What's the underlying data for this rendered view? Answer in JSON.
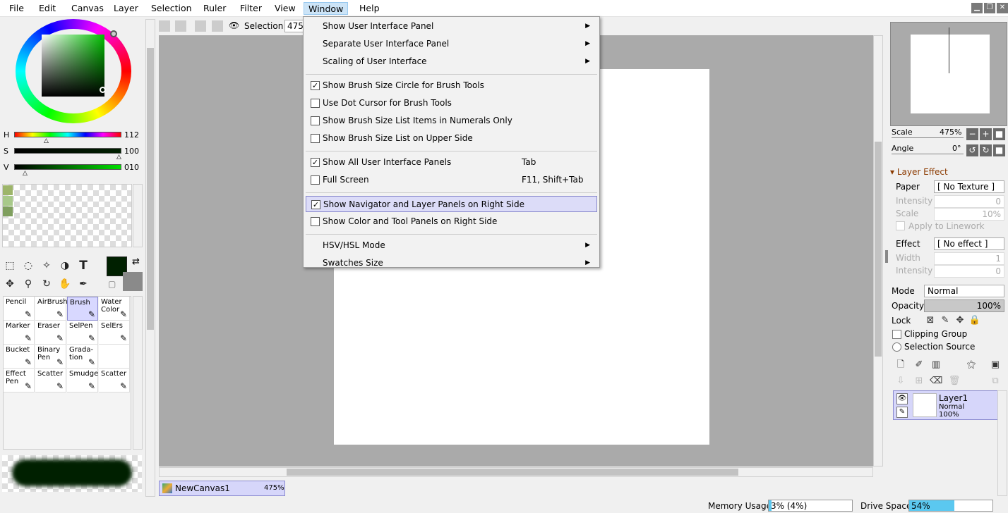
{
  "menubar": {
    "items": [
      "File",
      "Edit",
      "Canvas",
      "Layer",
      "Selection",
      "Ruler",
      "Filter",
      "View",
      "Window",
      "Help"
    ],
    "active": "Window"
  },
  "color_panel": {
    "h_label": "H",
    "h_value": "112",
    "s_label": "S",
    "s_value": "100",
    "v_label": "V",
    "v_value": "010",
    "swatches": [
      "#9db56a",
      "#a8c98a",
      "#7f9f5e"
    ],
    "primary_color": "#002000",
    "secondary_color": "#8a8a8a"
  },
  "brush_tools": {
    "cells": [
      {
        "label": "Pencil",
        "icon": "pencil-icon"
      },
      {
        "label": "AirBrush",
        "icon": "airbrush-icon"
      },
      {
        "label": "Brush",
        "icon": "brush-icon",
        "selected": true
      },
      {
        "label": "Water Color",
        "icon": "watercolor-icon"
      },
      {
        "label": "Marker",
        "icon": "marker-icon"
      },
      {
        "label": "Eraser",
        "icon": "eraser-icon"
      },
      {
        "label": "SelPen",
        "icon": "selpen-icon"
      },
      {
        "label": "SelErs",
        "icon": "selers-icon"
      },
      {
        "label": "Bucket",
        "icon": "bucket-icon"
      },
      {
        "label": "Binary Pen",
        "icon": "binary-pen-icon"
      },
      {
        "label": "Grada- tion",
        "icon": "gradation-icon"
      },
      {
        "label": "",
        "icon": ""
      },
      {
        "label": "Effect Pen",
        "icon": "effect-pen-icon"
      },
      {
        "label": "Scatter",
        "icon": "scatter-icon"
      },
      {
        "label": "Smudge",
        "icon": "smudge-icon"
      },
      {
        "label": "Scatter",
        "icon": "scatter-icon"
      }
    ]
  },
  "toolbar": {
    "selection_label": "Selection",
    "selection_value": "475"
  },
  "window_menu": {
    "groups": [
      [
        {
          "label": "Show User Interface Panel",
          "submenu": true
        },
        {
          "label": "Separate User Interface Panel",
          "submenu": true
        },
        {
          "label": "Scaling of User Interface",
          "submenu": true
        }
      ],
      [
        {
          "label": "Show Brush Size Circle for Brush Tools",
          "checkbox": true,
          "checked": true
        },
        {
          "label": "Use Dot Cursor for Brush Tools",
          "checkbox": true,
          "checked": false
        },
        {
          "label": "Show Brush Size List Items in Numerals Only",
          "checkbox": true,
          "checked": false
        },
        {
          "label": "Show Brush Size List on Upper Side",
          "checkbox": true,
          "checked": false
        }
      ],
      [
        {
          "label": "Show All User Interface Panels",
          "checkbox": true,
          "checked": true,
          "shortcut": "Tab"
        },
        {
          "label": "Full Screen",
          "checkbox": true,
          "checked": false,
          "shortcut": "F11, Shift+Tab"
        }
      ],
      [
        {
          "label": "Show Navigator and Layer Panels on Right Side",
          "checkbox": true,
          "checked": true,
          "highlighted": true
        },
        {
          "label": "Show Color and Tool Panels on Right Side",
          "checkbox": true,
          "checked": false
        }
      ],
      [
        {
          "label": "HSV/HSL Mode",
          "submenu": true
        },
        {
          "label": "Swatches Size",
          "submenu": true
        }
      ]
    ]
  },
  "canvas_tab": {
    "name": "NewCanvas1",
    "zoom": "475%"
  },
  "navigator": {
    "scale_label": "Scale",
    "scale_value": "475%",
    "angle_label": "Angle",
    "angle_value": "0°"
  },
  "layer_effect": {
    "title": "Layer Effect",
    "paper_label": "Paper",
    "paper_value": "[ No Texture ]",
    "intensity_label": "Intensity",
    "intensity_value": "0",
    "scale_label": "Scale",
    "scale_value": "10%",
    "apply_linework_label": "Apply to Linework",
    "effect_label": "Effect",
    "effect_value": "[ No effect ]",
    "width_label": "Width",
    "width_value": "1",
    "intensity2_label": "Intensity",
    "intensity2_value": "0"
  },
  "layer_props": {
    "mode_label": "Mode",
    "mode_value": "Normal",
    "opacity_label": "Opacity",
    "opacity_value": "100%",
    "lock_label": "Lock",
    "clipping_label": "Clipping Group",
    "selection_source_label": "Selection Source"
  },
  "layers": [
    {
      "name": "Layer1",
      "mode": "Normal",
      "opacity": "100%"
    }
  ],
  "statusbar": {
    "memory_label": "Memory Usage",
    "memory_value": "3% (4%)",
    "memory_fraction": 0.03,
    "drive_label": "Drive Space",
    "drive_value": "54%",
    "drive_fraction": 0.54
  }
}
